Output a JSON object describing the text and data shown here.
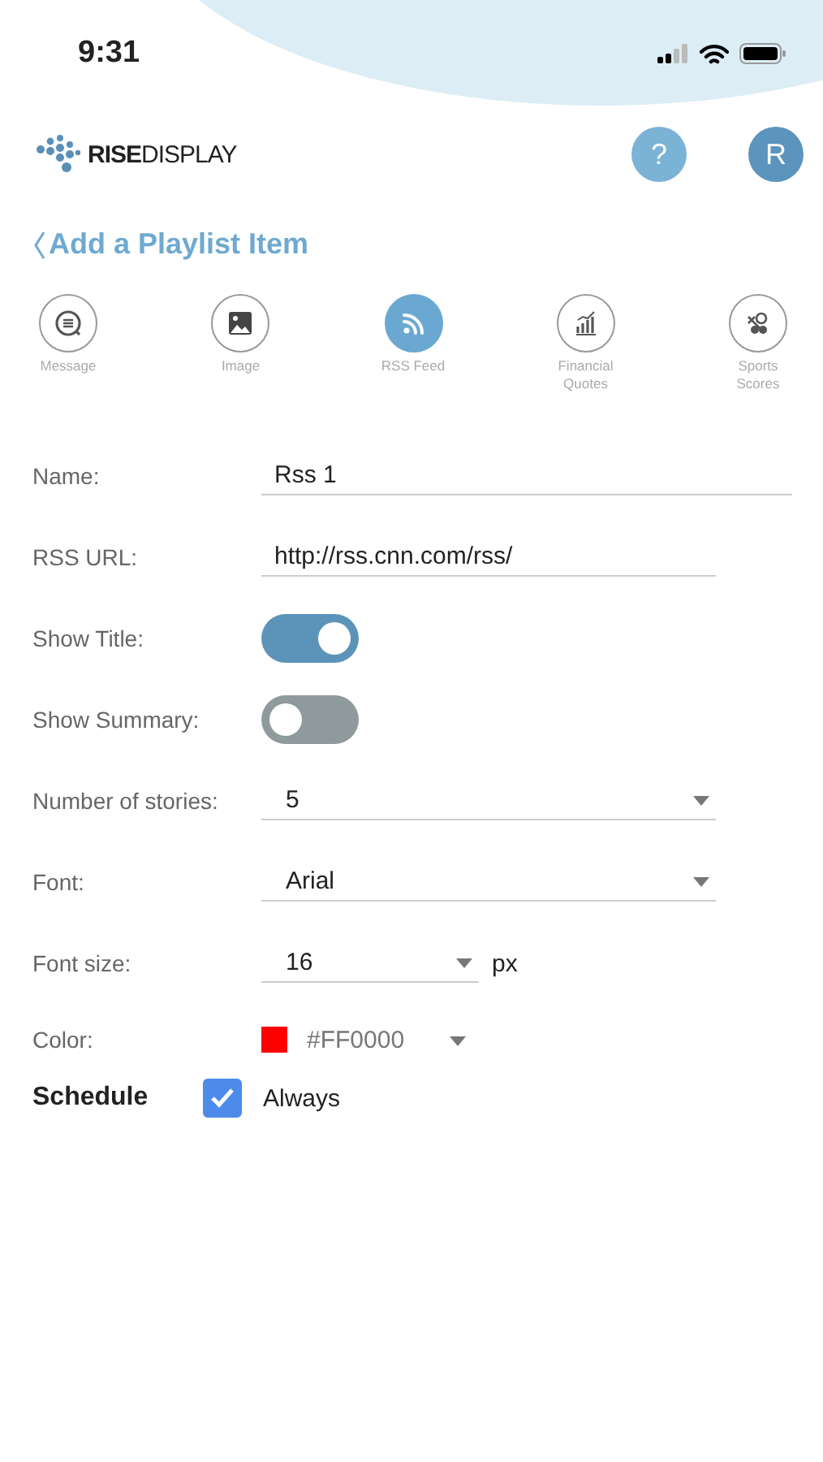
{
  "status_bar": {
    "time": "9:31"
  },
  "header": {
    "logo": {
      "bold": "RISE",
      "light": "DISPLAY"
    },
    "help_button": "?",
    "avatar": "R"
  },
  "back_title": "Add a Playlist Item",
  "item_types": [
    {
      "label": "Message",
      "kind": "message",
      "selected": false
    },
    {
      "label": "Image",
      "kind": "image",
      "selected": false
    },
    {
      "label": "RSS Feed",
      "kind": "rss",
      "selected": true
    },
    {
      "label": "Financial Quotes",
      "kind": "chart",
      "selected": false
    },
    {
      "label": "Sports Scores",
      "kind": "sports",
      "selected": false
    }
  ],
  "fields": [
    {
      "kind": "text",
      "label": "Name:",
      "value": "Rss 1",
      "wide": true
    },
    {
      "kind": "text",
      "label": "RSS URL:",
      "value": "http://rss.cnn.com/rss/",
      "wide": false
    },
    {
      "kind": "toggle",
      "label": "Show Title:",
      "on": true
    },
    {
      "kind": "toggle",
      "label": "Show Summary:",
      "on": false
    },
    {
      "kind": "select",
      "label": "Number of stories:",
      "value": "5"
    },
    {
      "kind": "select",
      "label": "Font:",
      "value": "Arial"
    },
    {
      "kind": "select_unit",
      "label": "Font size:",
      "value": "16",
      "unit": "px"
    },
    {
      "kind": "color",
      "label": "Color:",
      "value": "#FF0000",
      "color": "#ff0000"
    }
  ],
  "schedule": {
    "label": "Schedule",
    "option": "Always",
    "checked": true
  }
}
